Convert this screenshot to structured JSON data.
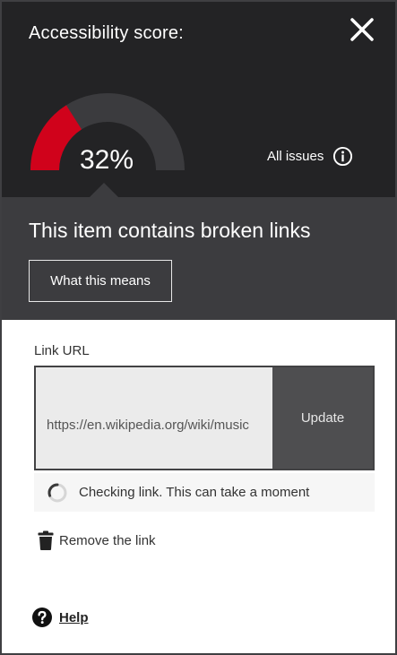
{
  "header": {
    "title": "Accessibility score:",
    "close_icon": "close-icon",
    "score_text": "32%",
    "score_value": 32,
    "all_issues_label": "All issues",
    "info_icon": "info-icon",
    "gauge_colors": {
      "fill": "#d0021b",
      "track": "#3b3b3e"
    }
  },
  "issue": {
    "heading": "This item contains broken links",
    "what_means_label": "What this means"
  },
  "link_form": {
    "label": "Link URL",
    "url_value": "https://en.wikipedia.org/wiki/music",
    "update_label": "Update",
    "checking_text": "Checking link. This can take a moment",
    "spinner_icon": "spinner-icon",
    "remove_label": "Remove the link",
    "trash_icon": "trash-icon"
  },
  "footer": {
    "help_label": "Help",
    "help_icon": "question-circle-icon"
  }
}
